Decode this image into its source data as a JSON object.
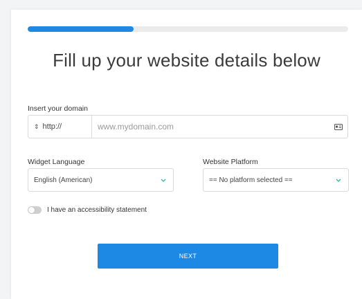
{
  "progress": {
    "value": 0.33,
    "color": "#1e88e5"
  },
  "title": "Fill up your website details below",
  "domain": {
    "label": "Insert your domain",
    "protocol": "http://",
    "placeholder": "www.mydomain.com",
    "value": "",
    "icon": "id-card-icon"
  },
  "language": {
    "label": "Widget Language",
    "selected": "English (American)"
  },
  "platform": {
    "label": "Website Platform",
    "selected": "== No platform selected =="
  },
  "accessibility": {
    "label": "I have an accessibility statement",
    "checked": false
  },
  "next_button": {
    "label": "NEXT"
  },
  "colors": {
    "accent": "#1e88e5",
    "chevron": "#2bb5a8"
  }
}
